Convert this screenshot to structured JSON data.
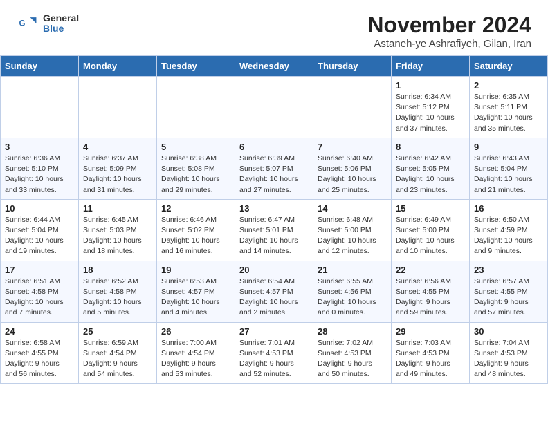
{
  "header": {
    "logo_general": "General",
    "logo_blue": "Blue",
    "month_title": "November 2024",
    "location": "Astaneh-ye Ashrafiyeh, Gilan, Iran"
  },
  "days_of_week": [
    "Sunday",
    "Monday",
    "Tuesday",
    "Wednesday",
    "Thursday",
    "Friday",
    "Saturday"
  ],
  "weeks": [
    [
      {
        "day": "",
        "info": ""
      },
      {
        "day": "",
        "info": ""
      },
      {
        "day": "",
        "info": ""
      },
      {
        "day": "",
        "info": ""
      },
      {
        "day": "",
        "info": ""
      },
      {
        "day": "1",
        "info": "Sunrise: 6:34 AM\nSunset: 5:12 PM\nDaylight: 10 hours\nand 37 minutes."
      },
      {
        "day": "2",
        "info": "Sunrise: 6:35 AM\nSunset: 5:11 PM\nDaylight: 10 hours\nand 35 minutes."
      }
    ],
    [
      {
        "day": "3",
        "info": "Sunrise: 6:36 AM\nSunset: 5:10 PM\nDaylight: 10 hours\nand 33 minutes."
      },
      {
        "day": "4",
        "info": "Sunrise: 6:37 AM\nSunset: 5:09 PM\nDaylight: 10 hours\nand 31 minutes."
      },
      {
        "day": "5",
        "info": "Sunrise: 6:38 AM\nSunset: 5:08 PM\nDaylight: 10 hours\nand 29 minutes."
      },
      {
        "day": "6",
        "info": "Sunrise: 6:39 AM\nSunset: 5:07 PM\nDaylight: 10 hours\nand 27 minutes."
      },
      {
        "day": "7",
        "info": "Sunrise: 6:40 AM\nSunset: 5:06 PM\nDaylight: 10 hours\nand 25 minutes."
      },
      {
        "day": "8",
        "info": "Sunrise: 6:42 AM\nSunset: 5:05 PM\nDaylight: 10 hours\nand 23 minutes."
      },
      {
        "day": "9",
        "info": "Sunrise: 6:43 AM\nSunset: 5:04 PM\nDaylight: 10 hours\nand 21 minutes."
      }
    ],
    [
      {
        "day": "10",
        "info": "Sunrise: 6:44 AM\nSunset: 5:04 PM\nDaylight: 10 hours\nand 19 minutes."
      },
      {
        "day": "11",
        "info": "Sunrise: 6:45 AM\nSunset: 5:03 PM\nDaylight: 10 hours\nand 18 minutes."
      },
      {
        "day": "12",
        "info": "Sunrise: 6:46 AM\nSunset: 5:02 PM\nDaylight: 10 hours\nand 16 minutes."
      },
      {
        "day": "13",
        "info": "Sunrise: 6:47 AM\nSunset: 5:01 PM\nDaylight: 10 hours\nand 14 minutes."
      },
      {
        "day": "14",
        "info": "Sunrise: 6:48 AM\nSunset: 5:00 PM\nDaylight: 10 hours\nand 12 minutes."
      },
      {
        "day": "15",
        "info": "Sunrise: 6:49 AM\nSunset: 5:00 PM\nDaylight: 10 hours\nand 10 minutes."
      },
      {
        "day": "16",
        "info": "Sunrise: 6:50 AM\nSunset: 4:59 PM\nDaylight: 10 hours\nand 9 minutes."
      }
    ],
    [
      {
        "day": "17",
        "info": "Sunrise: 6:51 AM\nSunset: 4:58 PM\nDaylight: 10 hours\nand 7 minutes."
      },
      {
        "day": "18",
        "info": "Sunrise: 6:52 AM\nSunset: 4:58 PM\nDaylight: 10 hours\nand 5 minutes."
      },
      {
        "day": "19",
        "info": "Sunrise: 6:53 AM\nSunset: 4:57 PM\nDaylight: 10 hours\nand 4 minutes."
      },
      {
        "day": "20",
        "info": "Sunrise: 6:54 AM\nSunset: 4:57 PM\nDaylight: 10 hours\nand 2 minutes."
      },
      {
        "day": "21",
        "info": "Sunrise: 6:55 AM\nSunset: 4:56 PM\nDaylight: 10 hours\nand 0 minutes."
      },
      {
        "day": "22",
        "info": "Sunrise: 6:56 AM\nSunset: 4:55 PM\nDaylight: 9 hours\nand 59 minutes."
      },
      {
        "day": "23",
        "info": "Sunrise: 6:57 AM\nSunset: 4:55 PM\nDaylight: 9 hours\nand 57 minutes."
      }
    ],
    [
      {
        "day": "24",
        "info": "Sunrise: 6:58 AM\nSunset: 4:55 PM\nDaylight: 9 hours\nand 56 minutes."
      },
      {
        "day": "25",
        "info": "Sunrise: 6:59 AM\nSunset: 4:54 PM\nDaylight: 9 hours\nand 54 minutes."
      },
      {
        "day": "26",
        "info": "Sunrise: 7:00 AM\nSunset: 4:54 PM\nDaylight: 9 hours\nand 53 minutes."
      },
      {
        "day": "27",
        "info": "Sunrise: 7:01 AM\nSunset: 4:53 PM\nDaylight: 9 hours\nand 52 minutes."
      },
      {
        "day": "28",
        "info": "Sunrise: 7:02 AM\nSunset: 4:53 PM\nDaylight: 9 hours\nand 50 minutes."
      },
      {
        "day": "29",
        "info": "Sunrise: 7:03 AM\nSunset: 4:53 PM\nDaylight: 9 hours\nand 49 minutes."
      },
      {
        "day": "30",
        "info": "Sunrise: 7:04 AM\nSunset: 4:53 PM\nDaylight: 9 hours\nand 48 minutes."
      }
    ]
  ]
}
